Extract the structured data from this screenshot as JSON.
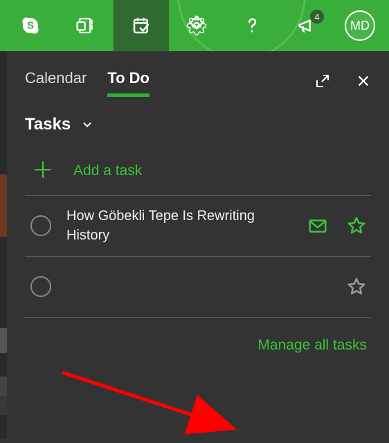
{
  "ribbon": {
    "items": [
      {
        "name": "skype-icon"
      },
      {
        "name": "onenote-icon"
      },
      {
        "name": "todo-icon",
        "active": true
      },
      {
        "name": "settings-icon"
      },
      {
        "name": "help-icon"
      },
      {
        "name": "announcements-icon",
        "badge": 4
      }
    ],
    "avatar_initials": "MD"
  },
  "panel": {
    "tabs": [
      {
        "label": "Calendar",
        "active": false
      },
      {
        "label": "To Do",
        "active": true
      }
    ],
    "section_title": "Tasks",
    "add_label": "Add a task",
    "tasks": [
      {
        "title": "How Göbekli Tepe Is Rewriting History",
        "has_mail": true,
        "starred": true
      },
      {
        "title": "",
        "has_mail": false,
        "starred": true
      }
    ],
    "manage_link": "Manage all tasks"
  }
}
